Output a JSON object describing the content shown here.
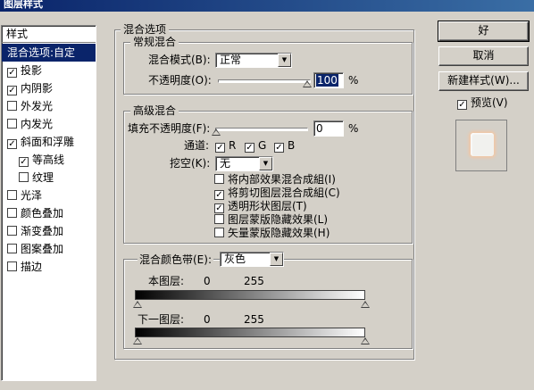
{
  "window": {
    "title": "图层样式"
  },
  "sidebar": {
    "header": "样式",
    "items": [
      {
        "label": "混合选项:自定",
        "selected": true,
        "has_checkbox": false,
        "checked": false,
        "indent": false
      },
      {
        "label": "投影",
        "selected": false,
        "has_checkbox": true,
        "checked": true,
        "indent": false
      },
      {
        "label": "内阴影",
        "selected": false,
        "has_checkbox": true,
        "checked": true,
        "indent": false
      },
      {
        "label": "外发光",
        "selected": false,
        "has_checkbox": true,
        "checked": false,
        "indent": false
      },
      {
        "label": "内发光",
        "selected": false,
        "has_checkbox": true,
        "checked": false,
        "indent": false
      },
      {
        "label": "斜面和浮雕",
        "selected": false,
        "has_checkbox": true,
        "checked": true,
        "indent": false
      },
      {
        "label": "等高线",
        "selected": false,
        "has_checkbox": true,
        "checked": true,
        "indent": true
      },
      {
        "label": "纹理",
        "selected": false,
        "has_checkbox": true,
        "checked": false,
        "indent": true
      },
      {
        "label": "光泽",
        "selected": false,
        "has_checkbox": true,
        "checked": false,
        "indent": false
      },
      {
        "label": "颜色叠加",
        "selected": false,
        "has_checkbox": true,
        "checked": false,
        "indent": false
      },
      {
        "label": "渐变叠加",
        "selected": false,
        "has_checkbox": true,
        "checked": false,
        "indent": false
      },
      {
        "label": "图案叠加",
        "selected": false,
        "has_checkbox": true,
        "checked": false,
        "indent": false
      },
      {
        "label": "描边",
        "selected": false,
        "has_checkbox": true,
        "checked": false,
        "indent": false
      }
    ]
  },
  "blending_options": {
    "title": "混合选项",
    "general": {
      "title": "常规混合",
      "blend_mode_label": "混合模式(B):",
      "blend_mode_value": "正常",
      "opacity_label": "不透明度(O):",
      "opacity_value": "100",
      "opacity_unit": "%",
      "opacity_level": 1.0
    },
    "advanced": {
      "title": "高级混合",
      "fill_opacity_label": "填充不透明度(F):",
      "fill_opacity_value": "0",
      "fill_opacity_unit": "%",
      "fill_opacity_level": 0,
      "channels_label": "通道:",
      "channels": [
        {
          "label": "R",
          "checked": true
        },
        {
          "label": "G",
          "checked": true
        },
        {
          "label": "B",
          "checked": true
        }
      ],
      "knockout_label": "挖空(K):",
      "knockout_value": "无",
      "options": [
        {
          "label": "将内部效果混合成組(I)",
          "checked": false
        },
        {
          "label": "将剪切图层混合成組(C)",
          "checked": true
        },
        {
          "label": "透明形状图层(T)",
          "checked": true
        },
        {
          "label": "图层蒙版隐藏效果(L)",
          "checked": false
        },
        {
          "label": "矢量蒙版隐藏效果(H)",
          "checked": false
        }
      ]
    },
    "blend_if": {
      "label": "混合颜色带(E):",
      "value": "灰色",
      "this_layer": {
        "label": "本图层:",
        "low": "0",
        "high": "255"
      },
      "underlying_layer": {
        "label": "下一图层:",
        "low": "0",
        "high": "255"
      }
    }
  },
  "buttons": {
    "ok": "好",
    "cancel": "取消",
    "new_style": "新建样式(W)...",
    "preview_label": "预览(V)",
    "preview_checked": true
  },
  "colors": {
    "dialog_bg": "#d4d0c8",
    "selection": "#0a246a",
    "title_gradient_start": "#0a246a",
    "title_gradient_end": "#3a6ea5"
  }
}
